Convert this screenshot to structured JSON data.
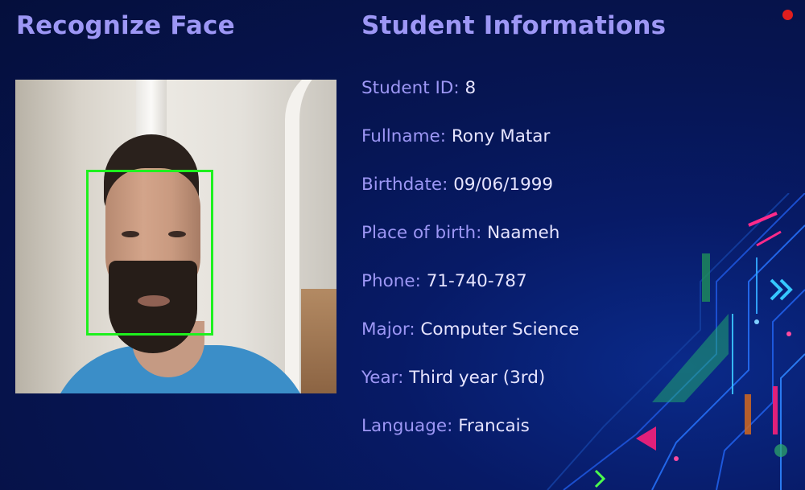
{
  "left_panel": {
    "title": "Recognize Face"
  },
  "right_panel": {
    "title": "Student Informations",
    "fields": [
      {
        "label": "Student ID:",
        "value": "8"
      },
      {
        "label": "Fullname:",
        "value": "Rony Matar"
      },
      {
        "label": "Birthdate:",
        "value": "09/06/1999"
      },
      {
        "label": "Place of birth:",
        "value": "Naameh"
      },
      {
        "label": "Phone:",
        "value": "71-740-787"
      },
      {
        "label": "Major:",
        "value": "Computer Science"
      },
      {
        "label": "Year:",
        "value": "Third year (3rd)"
      },
      {
        "label": "Language:",
        "value": "Francais"
      }
    ]
  },
  "colors": {
    "accent": "#9d97f5",
    "value_text": "#e6e4ff",
    "face_box": "#1ef01e",
    "close_dot": "#e01e1e",
    "background": "#061553"
  },
  "icons": {
    "close": "close-dot-icon"
  }
}
